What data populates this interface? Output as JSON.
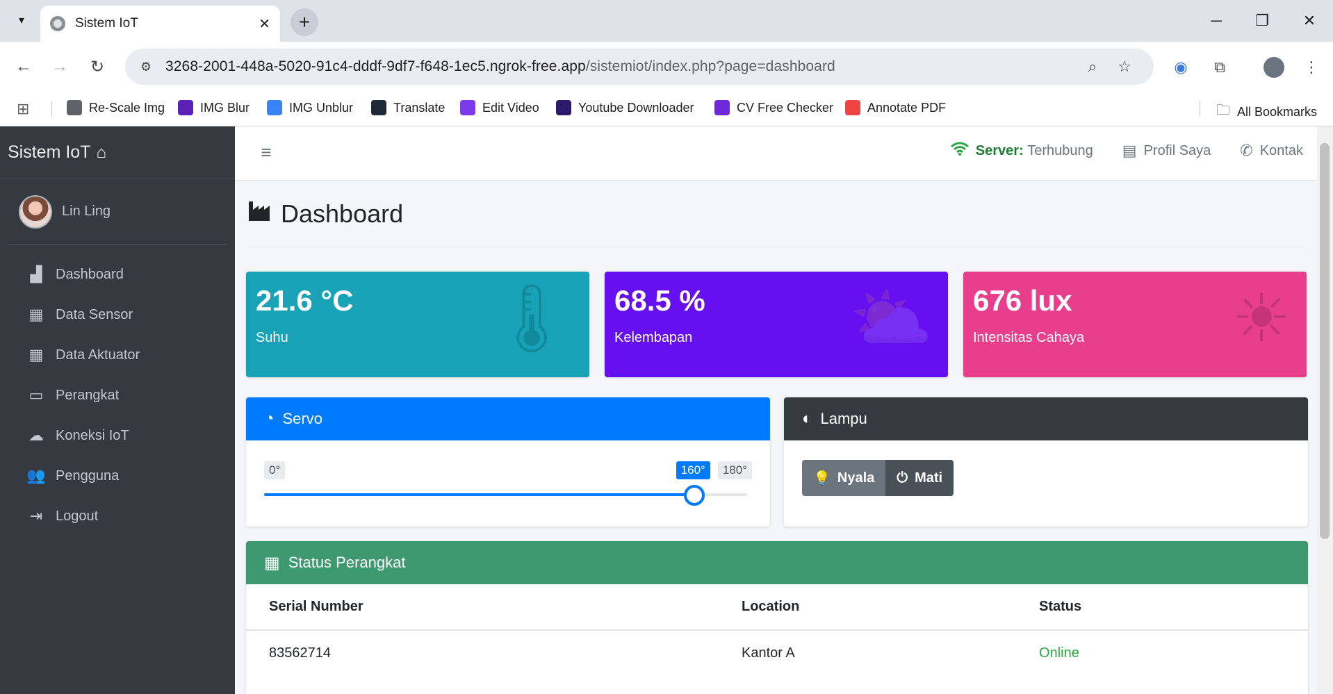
{
  "browser": {
    "tab_title": "Sistem IoT",
    "url_host": "3268-2001-448a-5020-91c4-dddf-9df7-f648-1ec5.ngrok-free.app",
    "url_path": "/sistemiot/index.php?page=dashboard",
    "bookmarks": [
      {
        "label": "Re-Scale Img",
        "color": "#5f6368"
      },
      {
        "label": "IMG Blur",
        "color": "#5b21b6"
      },
      {
        "label": "IMG Unblur",
        "color": "#3b82f6"
      },
      {
        "label": "Translate",
        "color": "#1f2937"
      },
      {
        "label": "Edit Video",
        "color": "#7c3aed"
      },
      {
        "label": "Youtube Downloader",
        "color": "#2d1b69"
      },
      {
        "label": "CV Free Checker",
        "color": "#6d28d9"
      },
      {
        "label": "Annotate PDF",
        "color": "#ef4444"
      }
    ],
    "all_bookmarks": "All Bookmarks"
  },
  "sidebar": {
    "brand": "Sistem IoT",
    "user": "Lin Ling",
    "menu": [
      {
        "label": "Dashboard",
        "icon": "chart-area-icon"
      },
      {
        "label": "Data Sensor",
        "icon": "grid-icon"
      },
      {
        "label": "Data Aktuator",
        "icon": "grid-icon"
      },
      {
        "label": "Perangkat",
        "icon": "device-icon"
      },
      {
        "label": "Koneksi IoT",
        "icon": "cloud-icon"
      },
      {
        "label": "Pengguna",
        "icon": "users-icon"
      },
      {
        "label": "Logout",
        "icon": "logout-icon"
      }
    ]
  },
  "topnav": {
    "server_label": "Server:",
    "server_status": "Terhubung",
    "profile": "Profil Saya",
    "contact": "Kontak"
  },
  "page": {
    "title": "Dashboard"
  },
  "stats": [
    {
      "value": "21.6 °C",
      "label": "Suhu",
      "color": "#17a2b8"
    },
    {
      "value": "68.5 %",
      "label": "Kelembapan",
      "color": "#6610f2"
    },
    {
      "value": "676 lux",
      "label": "Intensitas Cahaya",
      "color": "#e83e8c"
    }
  ],
  "servo": {
    "title": "Servo",
    "min_label": "0°",
    "max_label": "180°",
    "current_label": "160°",
    "value": 160,
    "min": 0,
    "max": 180,
    "color": "#007bff"
  },
  "lampu": {
    "title": "Lampu",
    "on_label": "Nyala",
    "off_label": "Mati"
  },
  "status_perangkat": {
    "title": "Status Perangkat",
    "color": "#3d9970",
    "columns": [
      "Serial Number",
      "Location",
      "Status"
    ],
    "rows": [
      {
        "serial": "83562714",
        "location": "Kantor A",
        "status": "Online"
      }
    ]
  }
}
